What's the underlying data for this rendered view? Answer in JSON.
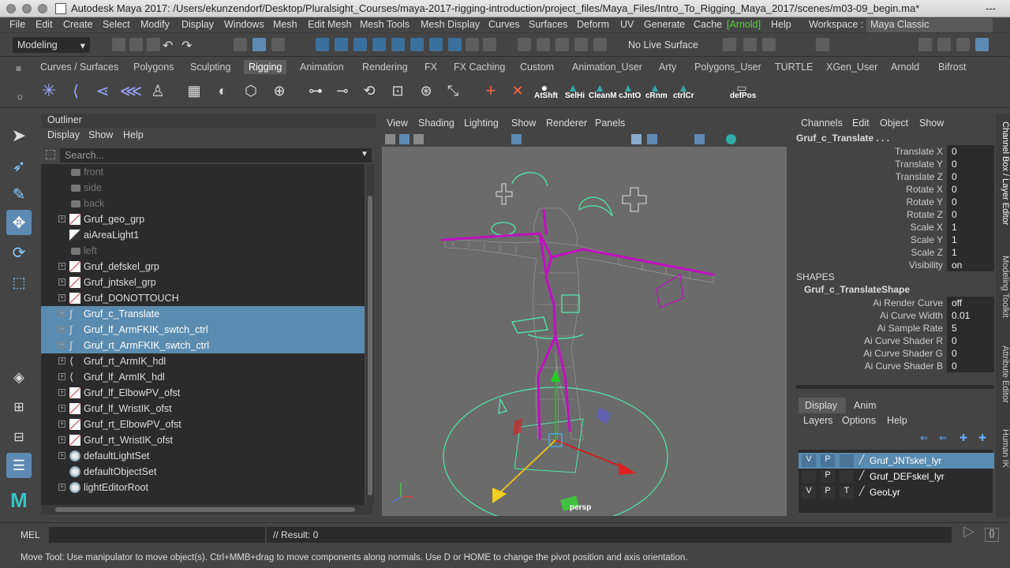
{
  "window": {
    "title": "Autodesk Maya 2017: /Users/ekunzendorf/Desktop/Pluralsight_Courses/maya-2017-rigging-introduction/project_files/Maya_Files/Intro_To_Rigging_Maya_2017/scenes/m03-09_begin.ma*",
    "ellipsis": "---"
  },
  "menubar": {
    "items": [
      "File",
      "Edit",
      "Create",
      "Select",
      "Modify",
      "Display",
      "Windows",
      "Mesh",
      "Edit Mesh",
      "Mesh Tools",
      "Mesh Display",
      "Curves",
      "Surfaces",
      "Deform",
      "UV",
      "Generate",
      "Cache",
      "[Arnold]",
      "Help"
    ],
    "workspace_label": "Workspace :",
    "workspace_value": "Maya Classic"
  },
  "statusline": {
    "mode": "Modeling",
    "live_surface": "No Live Surface"
  },
  "shelf": {
    "tabs": [
      "Curves / Surfaces",
      "Polygons",
      "Sculpting",
      "Rigging",
      "Animation",
      "Rendering",
      "FX",
      "FX Caching",
      "Custom",
      "Animation_User",
      "Arty",
      "Polygons_User",
      "TURTLE",
      "XGen_User",
      "Arnold",
      "Bifrost"
    ],
    "active_tab": "Rigging",
    "custom_buttons": [
      "AtShft",
      "SelHi",
      "CleanM",
      "cJntO",
      "cRnm",
      "ctrlCr",
      "defPos"
    ]
  },
  "outliner": {
    "title": "Outliner",
    "menu": [
      "Display",
      "Show",
      "Help"
    ],
    "search_placeholder": "Search...",
    "rows": [
      {
        "label": "front",
        "type": "camera",
        "dim": true,
        "expand": false
      },
      {
        "label": "side",
        "type": "camera",
        "dim": true,
        "expand": false
      },
      {
        "label": "back",
        "type": "camera",
        "dim": true,
        "expand": false
      },
      {
        "label": "Gruf_geo_grp",
        "type": "group",
        "dim": false,
        "expand": true
      },
      {
        "label": "aiAreaLight1",
        "type": "light",
        "dim": false,
        "expand": false
      },
      {
        "label": "left",
        "type": "camera",
        "dim": true,
        "expand": false
      },
      {
        "label": "Gruf_defskel_grp",
        "type": "group",
        "dim": false,
        "expand": true
      },
      {
        "label": "Gruf_jntskel_grp",
        "type": "group",
        "dim": false,
        "expand": true
      },
      {
        "label": "Gruf_DONOTTOUCH",
        "type": "group",
        "dim": false,
        "expand": true
      },
      {
        "label": "Gruf_c_Translate",
        "type": "curve",
        "dim": false,
        "expand": true,
        "selected": true
      },
      {
        "label": "Gruf_lf_ArmFKIK_swtch_ctrl",
        "type": "curve",
        "dim": false,
        "expand": true,
        "selected": true
      },
      {
        "label": "Gruf_rt_ArmFKIK_swtch_ctrl",
        "type": "curve",
        "dim": false,
        "expand": true,
        "selected": true
      },
      {
        "label": "Gruf_rt_ArmIK_hdl",
        "type": "ikhandle",
        "dim": false,
        "expand": true
      },
      {
        "label": "Gruf_lf_ArmIK_hdl",
        "type": "ikhandle",
        "dim": false,
        "expand": true
      },
      {
        "label": "Gruf_lf_ElbowPV_ofst",
        "type": "group",
        "dim": false,
        "expand": true
      },
      {
        "label": "Gruf_lf_WristIK_ofst",
        "type": "group",
        "dim": false,
        "expand": true
      },
      {
        "label": "Gruf_rt_ElbowPV_ofst",
        "type": "group",
        "dim": false,
        "expand": true
      },
      {
        "label": "Gruf_rt_WristIK_ofst",
        "type": "group",
        "dim": false,
        "expand": true
      },
      {
        "label": "defaultLightSet",
        "type": "set",
        "dim": false,
        "expand": true
      },
      {
        "label": "defaultObjectSet",
        "type": "set",
        "dim": false,
        "expand": false
      },
      {
        "label": "lightEditorRoot",
        "type": "set",
        "dim": false,
        "expand": true
      }
    ]
  },
  "viewport": {
    "menu": [
      "View",
      "Shading",
      "Lighting",
      "Show",
      "Renderer",
      "Panels"
    ],
    "camera_label": "persp"
  },
  "channel_box": {
    "menu": [
      "Channels",
      "Edit",
      "Object",
      "Show"
    ],
    "object_name": "Gruf_c_Translate . . .",
    "channels": [
      {
        "name": "Translate X",
        "value": "0"
      },
      {
        "name": "Translate Y",
        "value": "0"
      },
      {
        "name": "Translate Z",
        "value": "0"
      },
      {
        "name": "Rotate X",
        "value": "0"
      },
      {
        "name": "Rotate Y",
        "value": "0"
      },
      {
        "name": "Rotate Z",
        "value": "0"
      },
      {
        "name": "Scale X",
        "value": "1"
      },
      {
        "name": "Scale Y",
        "value": "1"
      },
      {
        "name": "Scale Z",
        "value": "1"
      },
      {
        "name": "Visibility",
        "value": "on"
      }
    ],
    "shapes_header": "SHAPES",
    "shape_name": "Gruf_c_TranslateShape",
    "shape_channels": [
      {
        "name": "Ai Render Curve",
        "value": "off"
      },
      {
        "name": "Ai Curve Width",
        "value": "0.01"
      },
      {
        "name": "Ai Sample Rate",
        "value": "5"
      },
      {
        "name": "Ai Curve Shader R",
        "value": "0"
      },
      {
        "name": "Ai Curve Shader G",
        "value": "0"
      },
      {
        "name": "Ai Curve Shader B",
        "value": "0"
      }
    ]
  },
  "side_tabs": [
    "Channel Box / Layer Editor",
    "Modeling Toolkit",
    "Attribute Editor",
    "Human IK"
  ],
  "layers": {
    "tabs": [
      "Display",
      "Anim"
    ],
    "active_tab": "Display",
    "menu": [
      "Layers",
      "Options",
      "Help"
    ],
    "rows": [
      {
        "v": "V",
        "p": "P",
        "t": "",
        "name": "Gruf_JNTskel_lyr",
        "selected": true
      },
      {
        "v": "",
        "p": "P",
        "t": "",
        "name": "Gruf_DEFskel_lyr",
        "selected": false
      },
      {
        "v": "V",
        "p": "P",
        "t": "T",
        "name": "GeoLyr",
        "selected": false
      }
    ]
  },
  "command": {
    "label": "MEL",
    "result": "// Result: 0"
  },
  "helpline": "Move Tool: Use manipulator to move object(s). Ctrl+MMB+drag to move components along normals. Use D or HOME to change the pivot position and axis orientation.",
  "colors": {
    "selection": "#5a8bb0",
    "active_tool": "#5d8ab3",
    "joint_magenta": "#c010c0",
    "control_green": "#50e8a8",
    "arnold_green": "#55d43a"
  }
}
